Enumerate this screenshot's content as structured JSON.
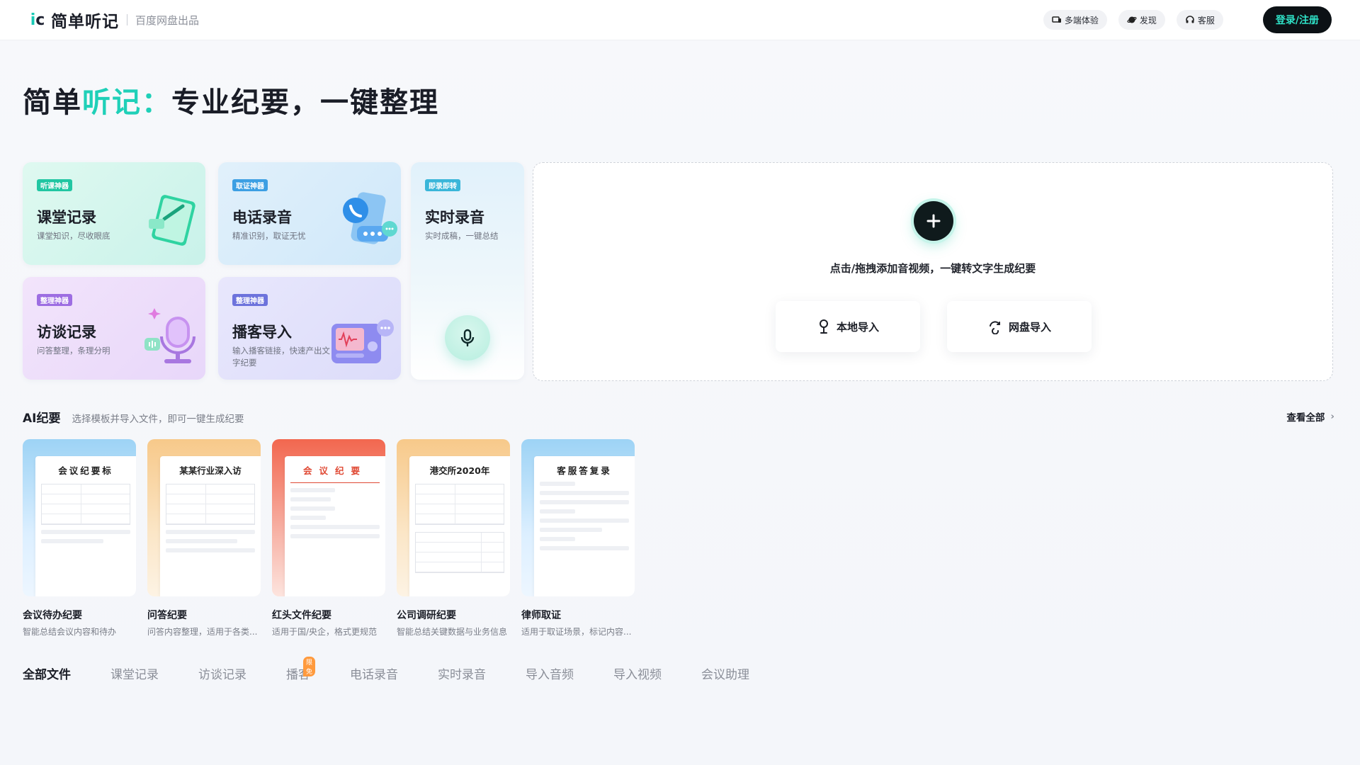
{
  "header": {
    "logo_text": "简单听记",
    "logo_sub": "百度网盘出品",
    "multi_device": "多端体验",
    "discover": "发现",
    "service": "客服",
    "login": "登录/注册"
  },
  "hero": {
    "part1": "简单",
    "accent": "听记：",
    "part2": "专业纪要，一键整理"
  },
  "cards": [
    {
      "tag": "听课神器",
      "title": "课堂记录",
      "desc": "课堂知识，尽收眼底"
    },
    {
      "tag": "取证神器",
      "title": "电话录音",
      "desc": "精准识别，取证无忧"
    },
    {
      "tag": "即录即转",
      "title": "实时录音",
      "desc": "实时成稿，一键总结"
    },
    {
      "tag": "整理神器",
      "title": "访谈记录",
      "desc": "问答整理，条理分明"
    },
    {
      "tag": "整理神器",
      "title": "播客导入",
      "desc": "输入播客链接，快速产出文字纪要"
    }
  ],
  "upload": {
    "hint": "点击/拖拽添加音视频，一键转文字生成纪要",
    "local": "本地导入",
    "cloud": "网盘导入"
  },
  "ai": {
    "title": "AI纪要",
    "subtitle": "选择模板并导入文件，即可一键生成纪要",
    "view_all": "查看全部",
    "templates": [
      {
        "thumb_title": "会议纪要标",
        "name": "会议待办纪要",
        "desc": "智能总结会议内容和待办"
      },
      {
        "thumb_title": "某某行业深入访",
        "name": "问答纪要",
        "desc": "问答内容整理，适用于各类..."
      },
      {
        "thumb_title": "会议纪要",
        "name": "红头文件纪要",
        "desc": "适用于国/央企，格式更规范"
      },
      {
        "thumb_title": "港交所2020年",
        "name": "公司调研纪要",
        "desc": "智能总结关键数据与业务信息"
      },
      {
        "thumb_title": "客服答复录",
        "name": "律师取证",
        "desc": "适用于取证场景，标记内容..."
      }
    ]
  },
  "tabs": {
    "items": [
      "全部文件",
      "课堂记录",
      "访谈记录",
      "播客",
      "电话录音",
      "实时录音",
      "导入音频",
      "导入视频",
      "会议助理"
    ],
    "badge": "限免"
  },
  "colors": {
    "accent": "#1fd0b8",
    "dark": "#0c1115"
  }
}
